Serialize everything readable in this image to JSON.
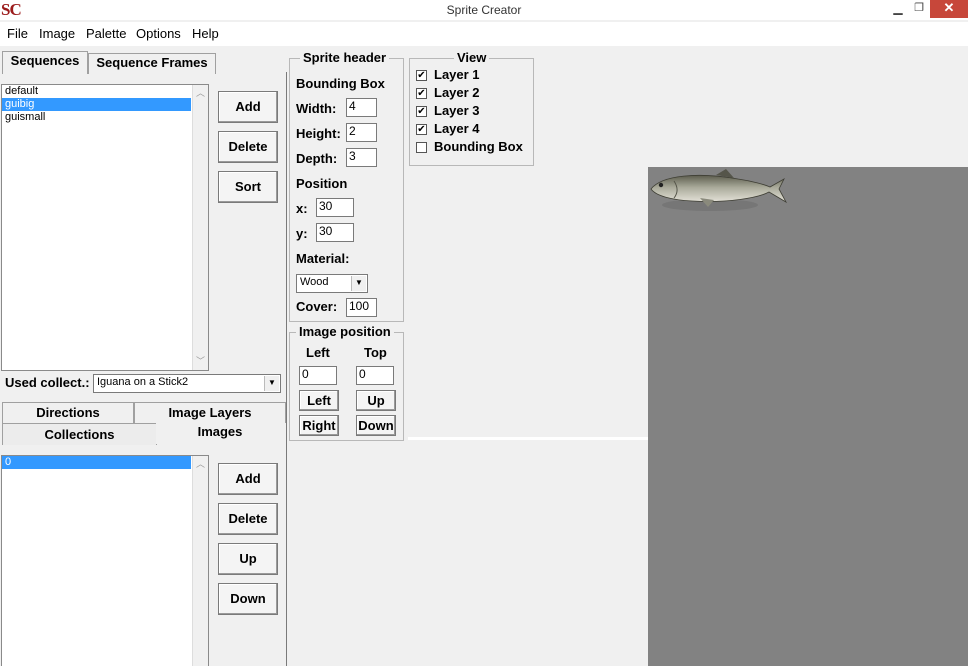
{
  "window": {
    "logo": "SC",
    "title": "Sprite Creator",
    "minimize": "▁",
    "maximize": "❐",
    "close": "✕"
  },
  "menubar": [
    "File",
    "Image",
    "Palette",
    "Options",
    "Help"
  ],
  "top_tabs": {
    "sequences": "Sequences",
    "sequence_frames": "Sequence Frames"
  },
  "sequences": {
    "items": [
      "default",
      "guibig",
      "guismall"
    ],
    "selected_index": 1,
    "buttons": {
      "add": "Add",
      "delete": "Delete",
      "sort": "Sort"
    }
  },
  "used_collect": {
    "label": "Used collect.:",
    "value": "Iguana on a Stick2"
  },
  "bottom_tabs": {
    "directions": "Directions",
    "image_layers": "Image Layers",
    "collections": "Collections",
    "images": "Images"
  },
  "images": {
    "items": [
      "0"
    ],
    "selected_index": 0,
    "buttons": {
      "add": "Add",
      "delete": "Delete",
      "up": "Up",
      "down": "Down"
    }
  },
  "sprite_header": {
    "title": "Sprite header",
    "bounding_box_label": "Bounding Box",
    "width_label": "Width:",
    "width_value": "4",
    "height_label": "Height:",
    "height_value": "2",
    "depth_label": "Depth:",
    "depth_value": "3",
    "position_label": "Position",
    "x_label": "x:",
    "x_value": "30",
    "y_label": "y:",
    "y_value": "30",
    "material_label": "Material:",
    "material_value": "Wood",
    "cover_label": "Cover:",
    "cover_value": "100"
  },
  "image_position": {
    "title": "Image position",
    "left_label": "Left",
    "top_label": "Top",
    "left_value": "0",
    "top_value": "0",
    "buttons": {
      "left": "Left",
      "up": "Up",
      "right": "Right",
      "down": "Down"
    }
  },
  "view": {
    "title": "View",
    "options": [
      {
        "label": "Layer 1",
        "checked": true
      },
      {
        "label": "Layer 2",
        "checked": true
      },
      {
        "label": "Layer 3",
        "checked": true
      },
      {
        "label": "Layer 4",
        "checked": true
      },
      {
        "label": "Bounding Box",
        "checked": false
      }
    ]
  },
  "colors": {
    "canvas": "#828282",
    "selection": "#3399ff",
    "close_button": "#c7473a"
  }
}
